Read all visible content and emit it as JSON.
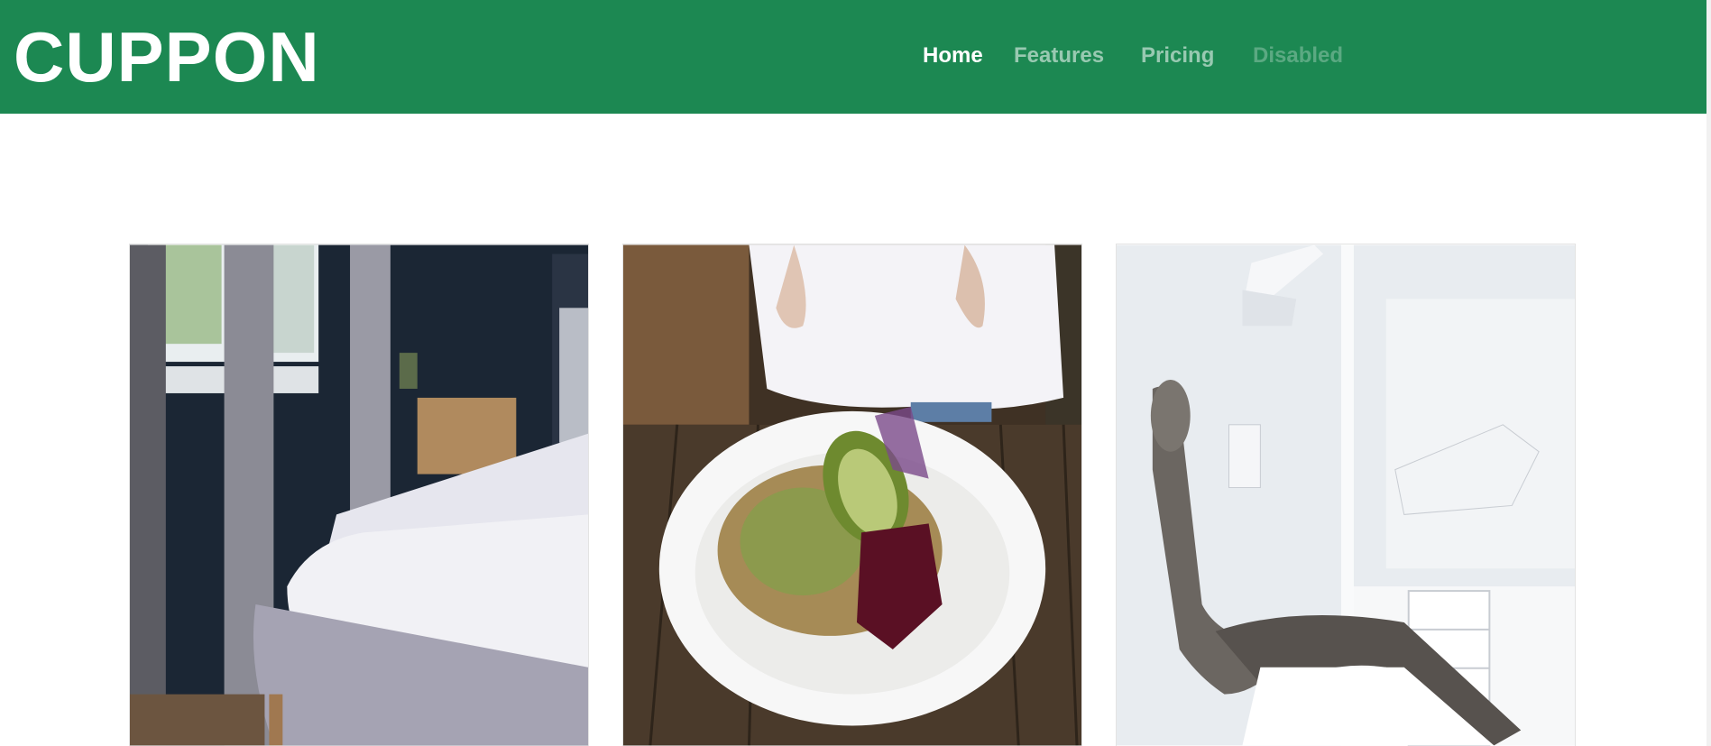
{
  "brand": {
    "name": "CUPPON"
  },
  "nav": {
    "items": [
      {
        "label": "Home",
        "state": "active"
      },
      {
        "label": "Features",
        "state": "normal"
      },
      {
        "label": "Pricing",
        "state": "normal"
      },
      {
        "label": "Disabled",
        "state": "disabled"
      }
    ]
  },
  "cards": [
    {
      "image": "bedroom-photo"
    },
    {
      "image": "salad-bowl-photo"
    },
    {
      "image": "dental-chair-photo"
    }
  ],
  "colors": {
    "navbar": "#1c8852",
    "background": "#ffffff"
  }
}
